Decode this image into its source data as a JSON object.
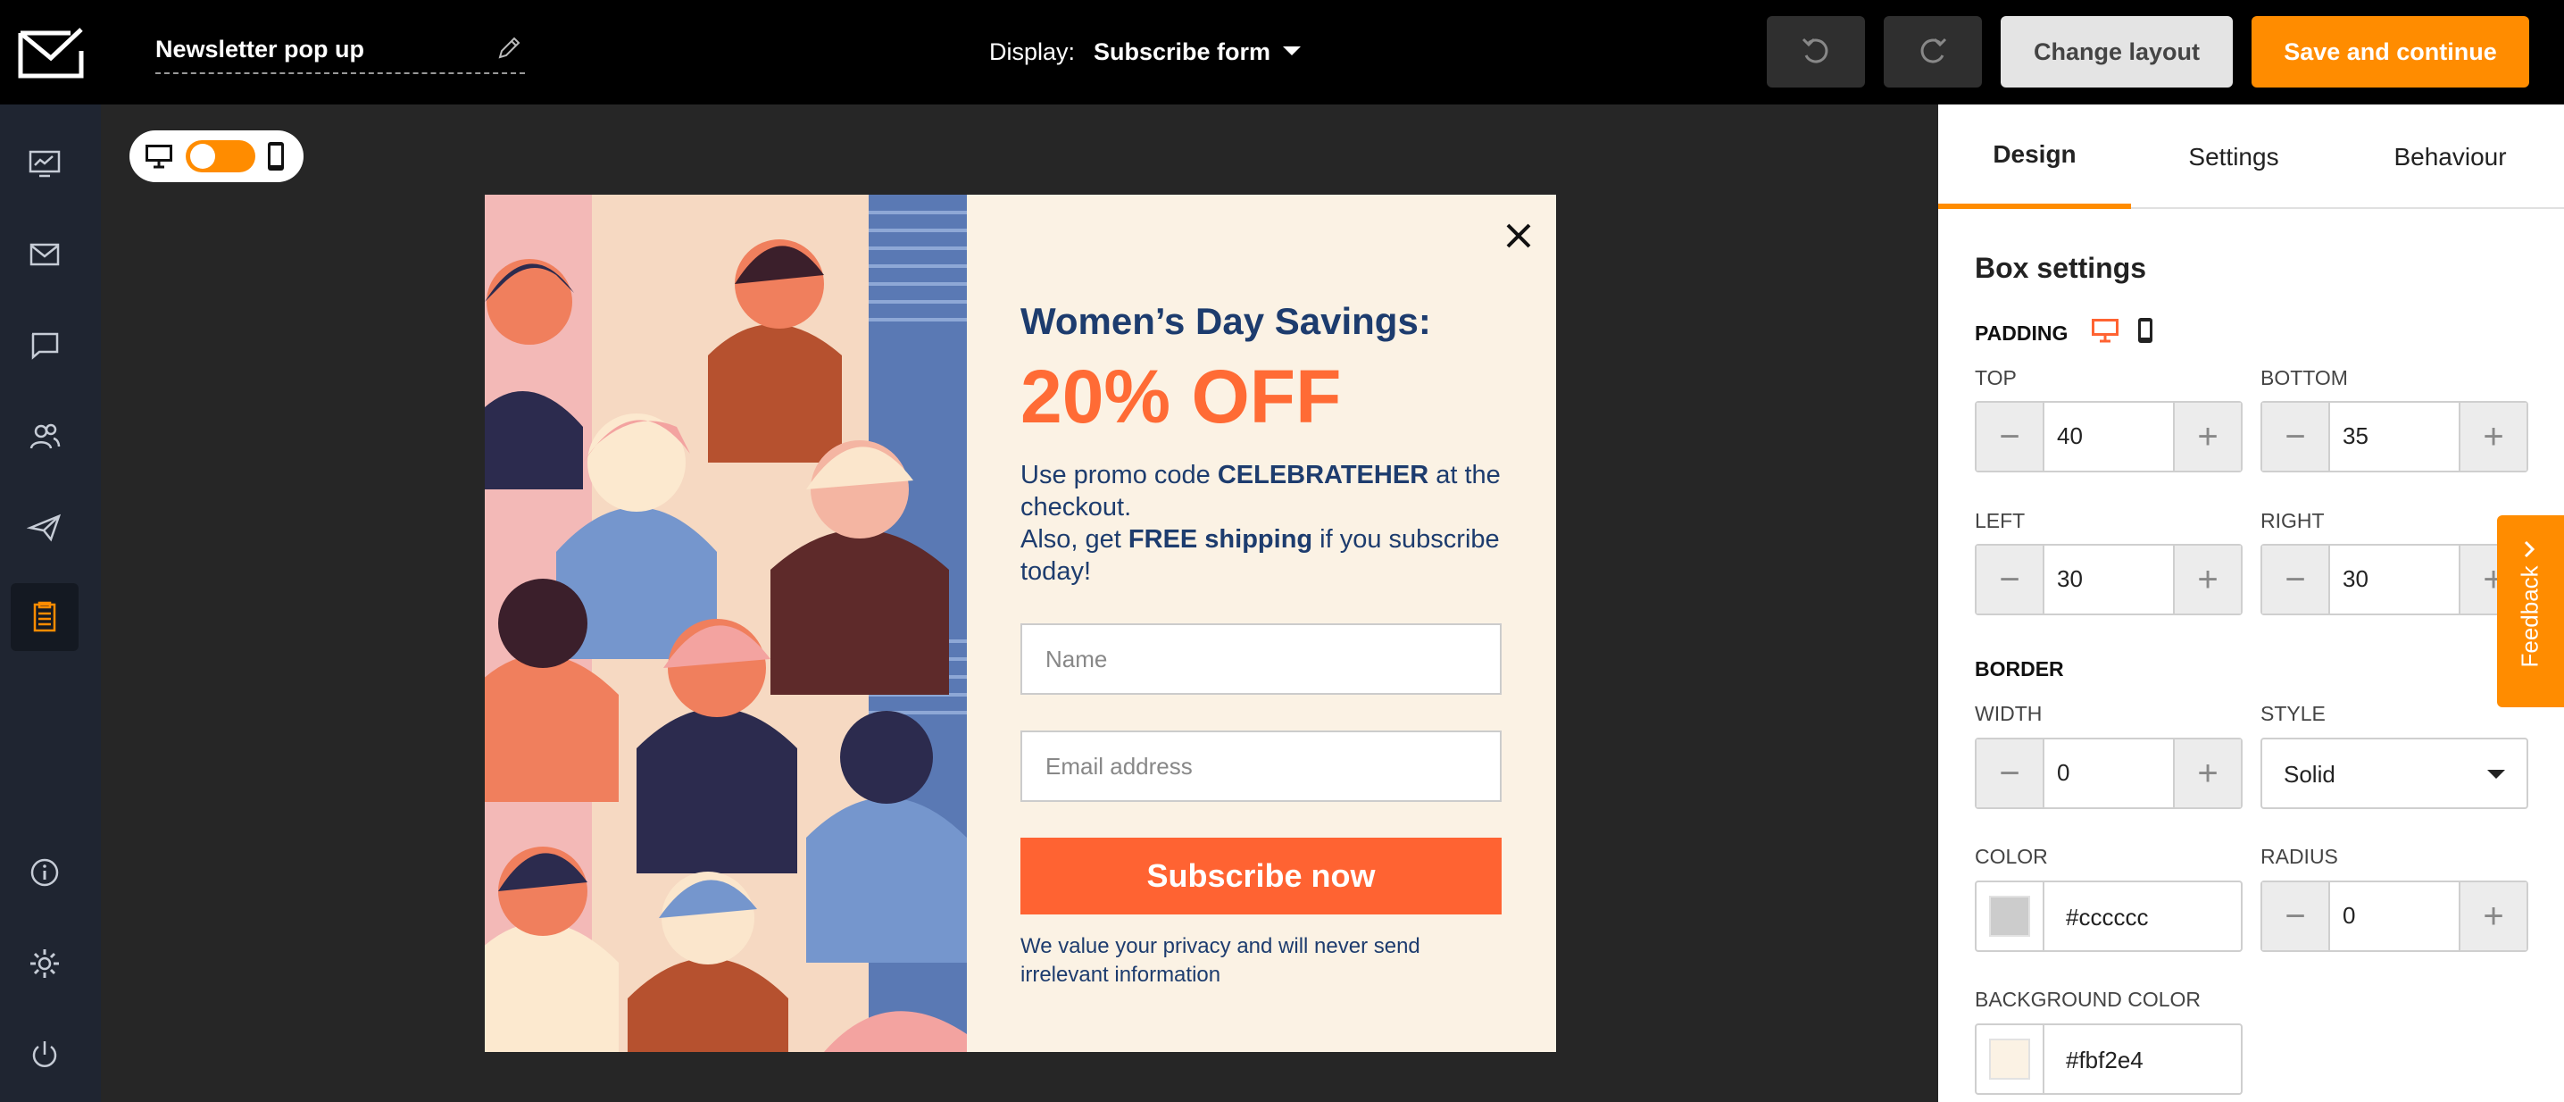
{
  "header": {
    "title": "Newsletter pop up",
    "display_label": "Display:",
    "display_value": "Subscribe form",
    "change_layout_label": "Change layout",
    "save_label": "Save and continue"
  },
  "sidebar": {
    "items": [
      {
        "icon": "monitor-chart-icon"
      },
      {
        "icon": "envelope-icon"
      },
      {
        "icon": "chat-bubble-icon"
      },
      {
        "icon": "contacts-icon"
      },
      {
        "icon": "paper-plane-icon"
      },
      {
        "icon": "forms-icon",
        "active": true
      },
      {
        "icon": "info-icon"
      },
      {
        "icon": "gear-icon"
      },
      {
        "icon": "power-icon"
      }
    ]
  },
  "popup": {
    "headline": "Women’s Day Savings:",
    "offer": "20% OFF",
    "body": {
      "l1a": "Use promo code ",
      "code": "CELEBRATEHER",
      "l1b": " at the checkout.",
      "l2a": "Also, get ",
      "free": "FREE shipping",
      "l2b": " if you subscribe today!"
    },
    "name_placeholder": "Name",
    "email_placeholder": "Email address",
    "button": "Subscribe now",
    "privacy": "We value your privacy and will never send irrelevant information"
  },
  "panel": {
    "tabs": [
      "Design",
      "Settings",
      "Behaviour"
    ],
    "active_tab": "Design",
    "heading": "Box settings",
    "padding": {
      "label": "PADDING",
      "top_label": "TOP",
      "top": "40",
      "bottom_label": "BOTTOM",
      "bottom": "35",
      "left_label": "LEFT",
      "left": "30",
      "right_label": "RIGHT",
      "right": "30"
    },
    "border": {
      "label": "BORDER",
      "width_label": "WIDTH",
      "width": "0",
      "style_label": "STYLE",
      "style": "Solid",
      "color_label": "COLOR",
      "color": "#cccccc",
      "radius_label": "RADIUS",
      "radius": "0"
    },
    "background": {
      "label": "BACKGROUND COLOR",
      "color": "#fbf2e4"
    }
  },
  "feedback_label": "Feedback",
  "colors": {
    "accent": "#ff8c00",
    "cta": "#ff6332",
    "headline": "#1d3c6e",
    "offer": "#ff6b35"
  }
}
